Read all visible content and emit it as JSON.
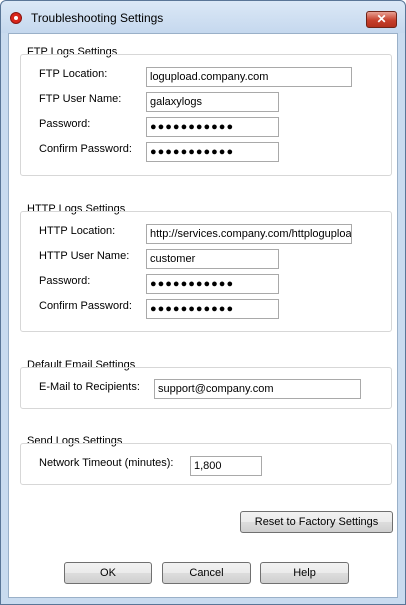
{
  "window": {
    "title": "Troubleshooting Settings",
    "close_glyph": "✕"
  },
  "ftp": {
    "group_title": "FTP Logs Settings",
    "location_label": "FTP Location:",
    "location_value": "logupload.company.com",
    "username_label": "FTP User Name:",
    "username_value": "galaxylogs",
    "password_label": "Password:",
    "password_value": "●●●●●●●●●●●",
    "confirm_label": "Confirm Password:",
    "confirm_value": "●●●●●●●●●●●"
  },
  "http": {
    "group_title": "HTTP Logs Settings",
    "location_label": "HTTP Location:",
    "location_value": "http://services.company.com/httploguploa",
    "username_label": "HTTP User Name:",
    "username_value": "customer",
    "password_label": "Password:",
    "password_value": "●●●●●●●●●●●",
    "confirm_label": "Confirm Password:",
    "confirm_value": "●●●●●●●●●●●"
  },
  "email": {
    "group_title": "Default Email Settings",
    "recipients_label": "E-Mail to Recipients:",
    "recipients_value": "support@company.com"
  },
  "sendlogs": {
    "group_title": "Send Logs Settings",
    "timeout_label": "Network Timeout (minutes):",
    "timeout_value": "1,800"
  },
  "buttons": {
    "reset": "Reset to Factory Settings",
    "ok": "OK",
    "cancel": "Cancel",
    "help": "Help"
  }
}
